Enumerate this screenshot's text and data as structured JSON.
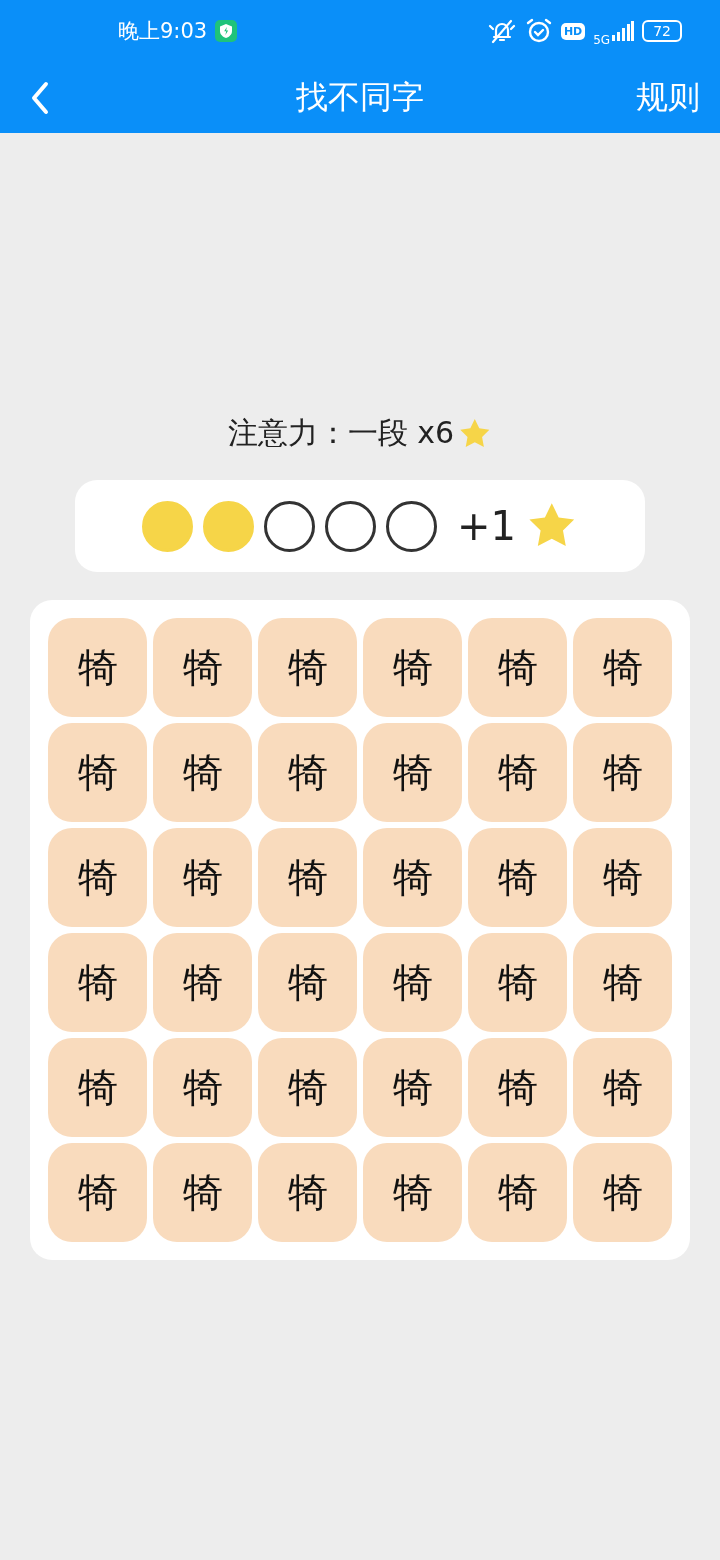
{
  "status_bar": {
    "time": "晚上9:03",
    "hd": "HD",
    "network": "5G",
    "battery": "72"
  },
  "header": {
    "title": "找不同字",
    "action": "规则"
  },
  "level_label": {
    "text": "注意力：一段 x6"
  },
  "progress": {
    "dots": [
      {
        "filled": true
      },
      {
        "filled": true
      },
      {
        "filled": false
      },
      {
        "filled": false
      },
      {
        "filled": false
      }
    ],
    "reward": "+1"
  },
  "grid": {
    "tiles": [
      "犄",
      "犄",
      "犄",
      "犄",
      "犄",
      "犄",
      "犄",
      "犄",
      "犄",
      "犄",
      "犄",
      "犄",
      "犄",
      "犄",
      "犄",
      "犄",
      "犄",
      "犄",
      "犄",
      "犄",
      "犄",
      "犄",
      "犄",
      "犄",
      "犄",
      "犄",
      "犄",
      "犄",
      "犄",
      "犄",
      "犄",
      "犄",
      "犄",
      "犄",
      "犄",
      "犄"
    ]
  }
}
